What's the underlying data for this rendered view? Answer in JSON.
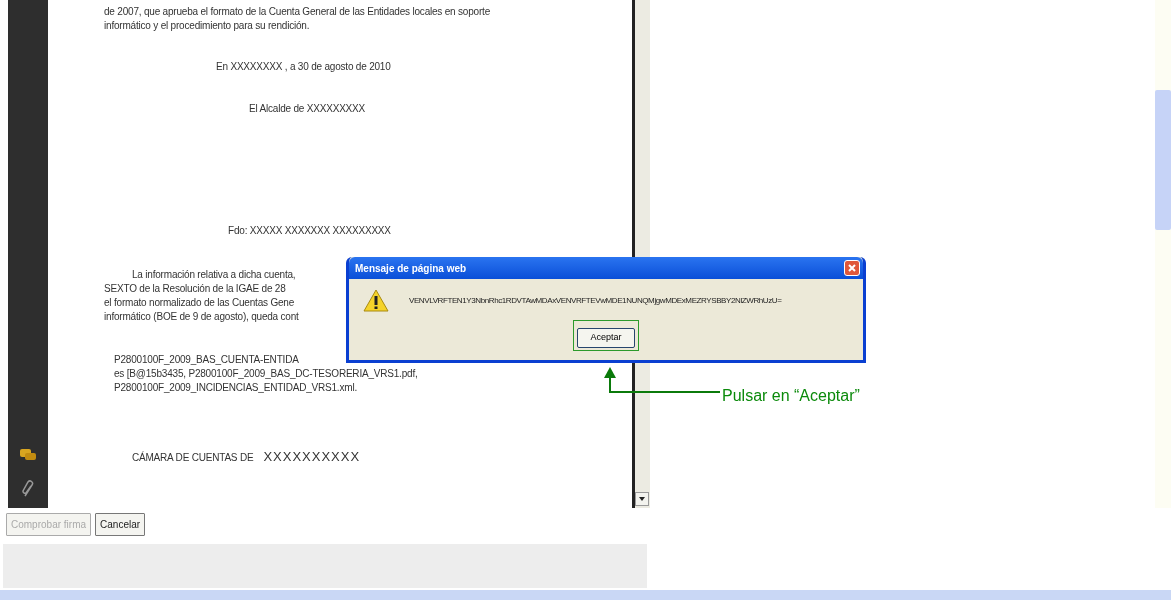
{
  "document": {
    "intro_lines": [
      "de 2007, que aprueba el formato de la Cuenta General de las Entidades locales en soporte",
      "informático y el procedimiento para su rendición."
    ],
    "place_date": "En XXXXXXXX , a 30 de agosto de 2010",
    "mayor": "El Alcalde de XXXXXXXXX",
    "signed": "Fdo: XXXXX XXXXXXX XXXXXXXXX",
    "paragraph_lines": [
      "La información relativa a dicha cuenta,",
      "SEXTO de la Resolución de la IGAE de 28",
      "el formato normalizado de las Cuentas Gene",
      "informático (BOE de 9 de agosto), queda cont"
    ],
    "file_lines": [
      "P2800100F_2009_BAS_CUENTA-ENTIDA",
      "es [B@15b3435, P2800100F_2009_BAS_DC-TESORERIA_VRS1.pdf,",
      "P2800100F_2009_INCIDENCIAS_ENTIDAD_VRS1.xml."
    ],
    "chamber": "CÁMARA DE CUENTAS DE",
    "chamber_name": "XXXXXXXXXX"
  },
  "buttons": [
    {
      "label": "Comprobar firma",
      "disabled": true
    },
    {
      "label": "Cancelar",
      "disabled": false
    }
  ],
  "dialog": {
    "title": "Mensaje de página web",
    "message": "VENVLVRFTEN1Y3NbnRhc1RDVTAwMDAxVENVRFTEVwMDE1NUNQMjgwMDExMEZRYSBBY2NlZWRhUzU=",
    "button": "Aceptar"
  },
  "annotation": {
    "text": "Pulsar en “Aceptar”"
  }
}
